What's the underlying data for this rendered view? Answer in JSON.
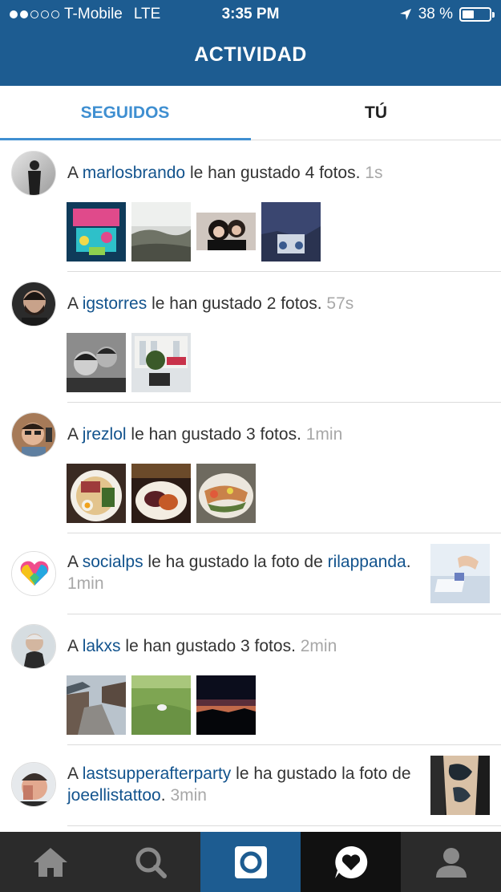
{
  "status_bar": {
    "carrier": "T-Mobile",
    "network": "LTE",
    "time": "3:35 PM",
    "battery": "38 %",
    "battery_level": 0.38
  },
  "header": {
    "title": "ACTIVIDAD"
  },
  "tabs": [
    {
      "label": "SEGUIDOS",
      "selected": true
    },
    {
      "label": "TÚ",
      "selected": false
    }
  ],
  "feed": [
    {
      "prefix": "A",
      "user": "marlosbrando",
      "action": "le han gustado 4 fotos.",
      "time": "1s",
      "photos": 4,
      "avatar_icon": "person-silhouette-avatar"
    },
    {
      "prefix": "A",
      "user": "igstorres",
      "action": "le han gustado 2 fotos.",
      "time": "57s",
      "photos": 2,
      "avatar_icon": "bearded-man-avatar"
    },
    {
      "prefix": "A",
      "user": "jrezlol",
      "action": "le han gustado 3 fotos.",
      "time": "1min",
      "photos": 3,
      "avatar_icon": "man-with-glasses-avatar"
    },
    {
      "prefix": "A",
      "user": "socialps",
      "action": "le ha gustado la foto de",
      "target": "rilappanda",
      "time": "1min",
      "avatar_icon": "heart-logo-avatar"
    },
    {
      "prefix": "A",
      "user": "lakxs",
      "action": "le han gustado 3 fotos.",
      "time": "2min",
      "photos": 3,
      "avatar_icon": "person-outdoors-avatar"
    },
    {
      "prefix": "A",
      "user": "lastsupperafterparty",
      "action": "le ha gustado la",
      "action2": "foto de",
      "target": "joeellistattoo",
      "time": "3min",
      "avatar_icon": "man-face-avatar"
    }
  ],
  "bottom_nav": [
    {
      "icon": "home-icon"
    },
    {
      "icon": "search-icon"
    },
    {
      "icon": "camera-icon"
    },
    {
      "icon": "activity-heart-icon",
      "active": true
    },
    {
      "icon": "profile-icon"
    }
  ],
  "colors": {
    "header": "#1d5c91",
    "accent": "#3f8fd1",
    "username": "#12538d",
    "timestamp": "#a8a8a8"
  }
}
